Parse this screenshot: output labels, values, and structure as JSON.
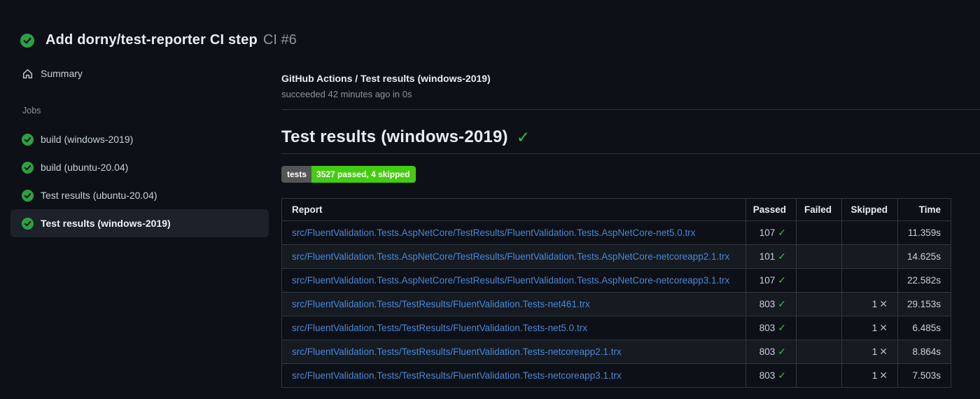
{
  "header": {
    "title": "Add dorny/test-reporter CI step",
    "run_number": "CI #6"
  },
  "sidebar": {
    "summary_label": "Summary",
    "jobs_label": "Jobs",
    "jobs": [
      {
        "label": "build (windows-2019)",
        "selected": false
      },
      {
        "label": "build (ubuntu-20.04)",
        "selected": false
      },
      {
        "label": "Test results (ubuntu-20.04)",
        "selected": false
      },
      {
        "label": "Test results (windows-2019)",
        "selected": true
      }
    ]
  },
  "main": {
    "breadcrumb": "GitHub Actions / Test results (windows-2019)",
    "status_line": "succeeded 42 minutes ago in 0s",
    "heading": "Test results (windows-2019)",
    "badge": {
      "label": "tests",
      "value": "3527 passed, 4 skipped",
      "label_bg": "#555555",
      "value_bg": "#44cc11"
    },
    "table": {
      "columns": [
        "Report",
        "Passed",
        "Failed",
        "Skipped",
        "Time"
      ],
      "rows": [
        {
          "report": "src/FluentValidation.Tests.AspNetCore/TestResults/FluentValidation.Tests.AspNetCore-net5.0.trx",
          "passed": "107",
          "failed": "",
          "skipped": "",
          "time": "11.359s"
        },
        {
          "report": "src/FluentValidation.Tests.AspNetCore/TestResults/FluentValidation.Tests.AspNetCore-netcoreapp2.1.trx",
          "passed": "101",
          "failed": "",
          "skipped": "",
          "time": "14.625s"
        },
        {
          "report": "src/FluentValidation.Tests.AspNetCore/TestResults/FluentValidation.Tests.AspNetCore-netcoreapp3.1.trx",
          "passed": "107",
          "failed": "",
          "skipped": "",
          "time": "22.582s"
        },
        {
          "report": "src/FluentValidation.Tests/TestResults/FluentValidation.Tests-net461.trx",
          "passed": "803",
          "failed": "",
          "skipped": "1",
          "time": "29.153s"
        },
        {
          "report": "src/FluentValidation.Tests/TestResults/FluentValidation.Tests-net5.0.trx",
          "passed": "803",
          "failed": "",
          "skipped": "1",
          "time": "6.485s"
        },
        {
          "report": "src/FluentValidation.Tests/TestResults/FluentValidation.Tests-netcoreapp2.1.trx",
          "passed": "803",
          "failed": "",
          "skipped": "1",
          "time": "8.864s"
        },
        {
          "report": "src/FluentValidation.Tests/TestResults/FluentValidation.Tests-netcoreapp3.1.trx",
          "passed": "803",
          "failed": "",
          "skipped": "1",
          "time": "7.503s"
        }
      ]
    }
  },
  "icons": {
    "passed_check": "✓",
    "skipped_x": "✕",
    "heading_check": "✓"
  },
  "colors": {
    "success_green": "#2ea043",
    "link_blue": "#4a86d6",
    "background": "#0d1117",
    "border": "#30363d"
  }
}
